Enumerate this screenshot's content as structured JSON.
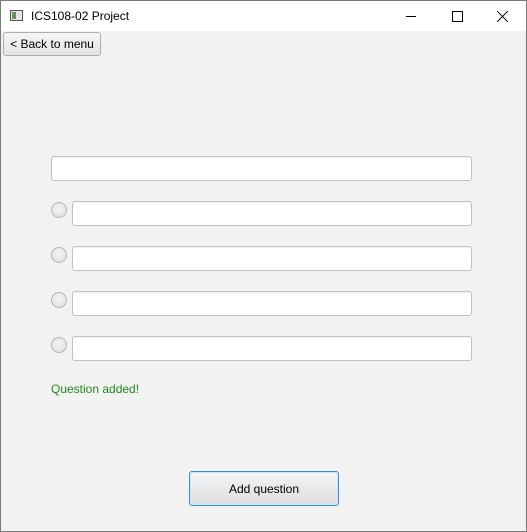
{
  "window": {
    "title": "ICS108-02 Project",
    "icons": [
      "app-icon",
      "minimize-icon",
      "maximize-icon",
      "close-icon"
    ]
  },
  "toolbar": {
    "back_label": "< Back to menu"
  },
  "form": {
    "question": {
      "value": "",
      "placeholder": ""
    },
    "answers": [
      {
        "value": "",
        "placeholder": "",
        "selected": false
      },
      {
        "value": "",
        "placeholder": "",
        "selected": false
      },
      {
        "value": "",
        "placeholder": "",
        "selected": false
      },
      {
        "value": "",
        "placeholder": "",
        "selected": false
      }
    ],
    "status_text": "Question added!",
    "add_label": "Add question"
  },
  "colors": {
    "status_text": "#1f8a1f",
    "focus_border": "#3d8fd4",
    "background": "#f2f2f2"
  }
}
